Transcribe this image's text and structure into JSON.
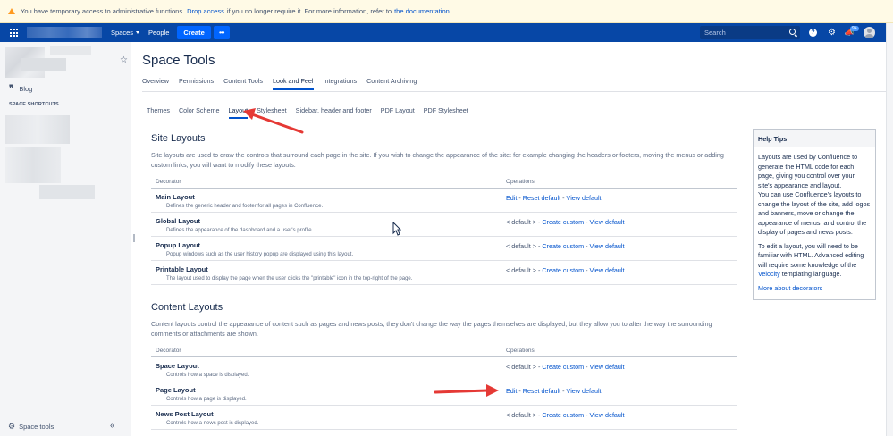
{
  "banner": {
    "text_before": "You have temporary access to administrative functions.",
    "drop_link": "Drop access",
    "text_middle": "if you no longer require it. For more information, refer to",
    "doc_link": "the documentation."
  },
  "topnav": {
    "spaces": "Spaces",
    "people": "People",
    "create": "Create",
    "more": "•••",
    "search_placeholder": "Search",
    "notifications_badge": "9+"
  },
  "sidebar": {
    "blog": "Blog",
    "shortcuts": "SPACE SHORTCUTS",
    "space_tools": "Space tools"
  },
  "page": {
    "title": "Space Tools",
    "tabs": [
      "Overview",
      "Permissions",
      "Content Tools",
      "Look and Feel",
      "Integrations",
      "Content Archiving"
    ],
    "active_tab": "Look and Feel",
    "subtabs": [
      "Themes",
      "Color Scheme",
      "Layout",
      "Stylesheet",
      "Sidebar, header and footer",
      "PDF Layout",
      "PDF Stylesheet"
    ],
    "active_subtab": "Layout"
  },
  "site_layouts": {
    "title": "Site Layouts",
    "description": "Site layouts are used to draw the controls that surround each page in the site. If you wish to change the appearance of the site: for example changing the headers or footers, moving the menus or adding custom links, you will want to modify these layouts.",
    "col_decorator": "Decorator",
    "col_operations": "Operations",
    "rows": [
      {
        "name": "Main Layout",
        "desc": "Defines the generic header and footer for all pages in Confluence.",
        "op1": "Edit",
        "op2": "Reset default",
        "op3": "View default"
      },
      {
        "name": "Global Layout",
        "desc": "Defines the appearance of the dashboard and a user's profile.",
        "op1": "< default >",
        "op2": "Create custom",
        "op3": "View default"
      },
      {
        "name": "Popup Layout",
        "desc": "Popup windows such as the user history popup are displayed using this layout.",
        "op1": "< default >",
        "op2": "Create custom",
        "op3": "View default"
      },
      {
        "name": "Printable Layout",
        "desc": "The layout used to display the page when the user clicks the \"printable\" icon in the top-right of the page.",
        "op1": "< default >",
        "op2": "Create custom",
        "op3": "View default"
      }
    ]
  },
  "content_layouts": {
    "title": "Content Layouts",
    "description": "Content layouts control the appearance of content such as pages and news posts; they don't change the way the pages themselves are displayed, but they allow you to alter the way the surrounding comments or attachments are shown.",
    "col_decorator": "Decorator",
    "col_operations": "Operations",
    "rows": [
      {
        "name": "Space Layout",
        "desc": "Controls how a space is displayed.",
        "op1": "< default >",
        "op2": "Create custom",
        "op3": "View default"
      },
      {
        "name": "Page Layout",
        "desc": "Controls how a page is displayed.",
        "op1": "Edit",
        "op2": "Reset default",
        "op3": "View default"
      },
      {
        "name": "News Post Layout",
        "desc": "Controls how a news post is displayed.",
        "op1": "< default >",
        "op2": "Create custom",
        "op3": "View default"
      }
    ]
  },
  "help": {
    "title": "Help Tips",
    "p1": "Layouts are used by Confluence to generate the HTML code for each page, giving you control over your site's appearance and layout.",
    "p2": "You can use Confluence's layouts to change the layout of the site, add logos and banners, move or change the appearance of menus, and control the display of pages and news posts.",
    "p3_before": "To edit a layout, you will need to be familiar with HTML. Advanced editing will require some knowledge of the",
    "p3_link": "Velocity",
    "p3_after": "templating language.",
    "more": "More about decorators"
  },
  "colors": {
    "nav": "#0747a6",
    "link": "#0052cc",
    "annotation_arrow": "#e53935"
  }
}
